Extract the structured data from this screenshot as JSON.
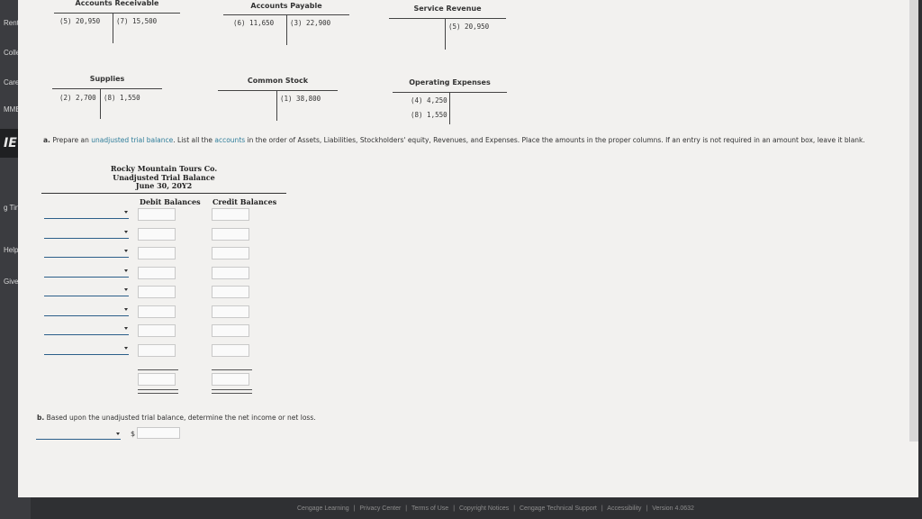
{
  "sidebar": {
    "items": [
      "Renta",
      "Colle",
      "Caree",
      "MMEN",
      "IE",
      "g Tin",
      "Help",
      "Give"
    ]
  },
  "t_accounts": [
    {
      "name": "Accounts Receivable",
      "debits": [
        "(5) 20,950"
      ],
      "credits": [
        "(7) 15,500"
      ]
    },
    {
      "name": "Accounts Payable",
      "debits": [
        "(6) 11,650"
      ],
      "credits": [
        "(3) 22,900"
      ]
    },
    {
      "name": "Service Revenue",
      "debits": [],
      "credits": [
        "(5) 20,950"
      ]
    },
    {
      "name": "Supplies",
      "debits": [
        "(2) 2,700"
      ],
      "credits": [
        "(8) 1,550"
      ]
    },
    {
      "name": "Common Stock",
      "debits": [],
      "credits": [
        "(1) 38,800"
      ]
    },
    {
      "name": "Operating Expenses",
      "debits": [
        "(4) 4,250",
        "(8) 1,550"
      ],
      "credits": []
    }
  ],
  "instructions": {
    "prefix": "a.",
    "part1": "Prepare an ",
    "link1": "unadjusted trial balance",
    "part2": ". List all the ",
    "link2": "accounts",
    "part3": " in the order of Assets, Liabilities, Stockholders' equity, Revenues, and Expenses. Place the amounts in the proper columns. If an entry is not required in an amount box, leave it blank."
  },
  "trial_balance": {
    "company": "Rocky Mountain Tours Co.",
    "title": "Unadjusted Trial Balance",
    "date": "June 30, 20Y2",
    "debit_header": "Debit Balances",
    "credit_header": "Credit Balances",
    "row_count": 8
  },
  "part_b": {
    "prefix": "b.",
    "text": "Based upon the unadjusted trial balance, determine the net income or net loss.",
    "currency": "$"
  },
  "footer": {
    "links": [
      "Cengage Learning",
      "Privacy Center",
      "Terms of Use",
      "Copyright Notices",
      "Cengage Technical Support",
      "Accessibility",
      "Version 4.0632"
    ]
  }
}
